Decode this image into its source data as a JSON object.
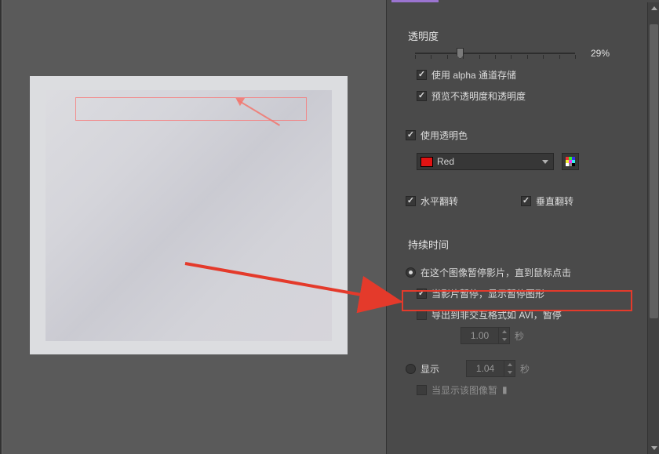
{
  "opacity": {
    "title": "透明度",
    "value_text": "29%",
    "value_pct": 29,
    "use_alpha_label": "使用 alpha 通道存储",
    "use_alpha_checked": true,
    "preview_label": "预览不透明度和透明度",
    "preview_checked": true
  },
  "trans_color": {
    "use_label": "使用透明色",
    "use_checked": true,
    "selected": "Red"
  },
  "flip": {
    "h_label": "水平翻转",
    "h_checked": true,
    "v_label": "垂直翻转",
    "v_checked": true
  },
  "duration": {
    "title": "持续时间",
    "pause_label": "在这个图像暂停影片，直到鼠标点击",
    "pause_selected": true,
    "show_pause_graphic_label": "当影片暂停，显示暂停图形",
    "show_pause_graphic_checked": true,
    "export_pause_label": "导出到非交互格式如 AVI，暂停",
    "export_pause_checked": false,
    "export_pause_spin": "1.00",
    "export_pause_unit": "秒",
    "display_label": "显示",
    "display_selected": false,
    "display_spin": "1.04",
    "display_unit": "秒",
    "display_current_label": "当显示该图像暂",
    "display_current_checked": false
  }
}
